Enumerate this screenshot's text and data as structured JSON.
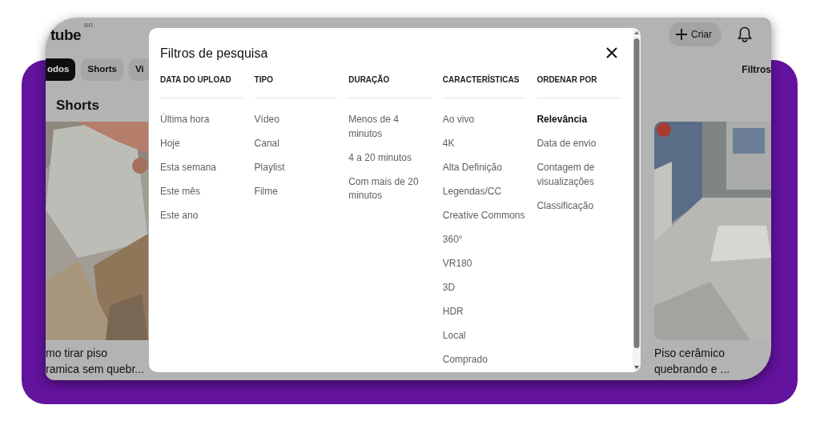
{
  "header": {
    "logo": "tube",
    "region": "BR",
    "create_button": "Criar"
  },
  "chips": [
    {
      "label": "odos",
      "selected": true
    },
    {
      "label": "Shorts",
      "selected": false
    },
    {
      "label": "Vi",
      "selected": false
    }
  ],
  "filters_button": "Filtros",
  "section_title": "Shorts",
  "videos": [
    {
      "kind": "picture",
      "title_lines": [
        "mo tirar piso",
        "ramica sem quebr..."
      ]
    },
    {
      "kind": "picture",
      "title_lines": [
        "Piso cerâmico",
        "quebrando e ..."
      ]
    }
  ],
  "dialog": {
    "title": "Filtros de pesquisa",
    "columns": [
      {
        "heading": "DATA DO UPLOAD",
        "options": [
          {
            "label": "Última hora",
            "selected": false
          },
          {
            "label": "Hoje",
            "selected": false
          },
          {
            "label": "Esta semana",
            "selected": false
          },
          {
            "label": "Este mês",
            "selected": false
          },
          {
            "label": "Este ano",
            "selected": false
          }
        ]
      },
      {
        "heading": "TIPO",
        "options": [
          {
            "label": "Vídeo",
            "selected": false
          },
          {
            "label": "Canal",
            "selected": false
          },
          {
            "label": "Playlist",
            "selected": false
          },
          {
            "label": "Filme",
            "selected": false
          }
        ]
      },
      {
        "heading": "DURAÇÃO",
        "options": [
          {
            "label": "Menos de 4 minutos",
            "selected": false
          },
          {
            "label": "4 a 20 minutos",
            "selected": false
          },
          {
            "label": "Com mais de 20 minutos",
            "selected": false
          }
        ]
      },
      {
        "heading": "CARACTERÍSTICAS",
        "options": [
          {
            "label": "Ao vivo",
            "selected": false
          },
          {
            "label": "4K",
            "selected": false
          },
          {
            "label": "Alta Definição",
            "selected": false
          },
          {
            "label": "Legendas/CC",
            "selected": false
          },
          {
            "label": "Creative Commons",
            "selected": false
          },
          {
            "label": "360°",
            "selected": false
          },
          {
            "label": "VR180",
            "selected": false
          },
          {
            "label": "3D",
            "selected": false
          },
          {
            "label": "HDR",
            "selected": false
          },
          {
            "label": "Local",
            "selected": false
          },
          {
            "label": "Comprado",
            "selected": false
          }
        ]
      },
      {
        "heading": "ORDENAR POR",
        "options": [
          {
            "label": "Relevância",
            "selected": true
          },
          {
            "label": "Data de envio",
            "selected": false
          },
          {
            "label": "Contagem de visualizações",
            "selected": false
          },
          {
            "label": "Classificação",
            "selected": false
          }
        ]
      }
    ]
  }
}
